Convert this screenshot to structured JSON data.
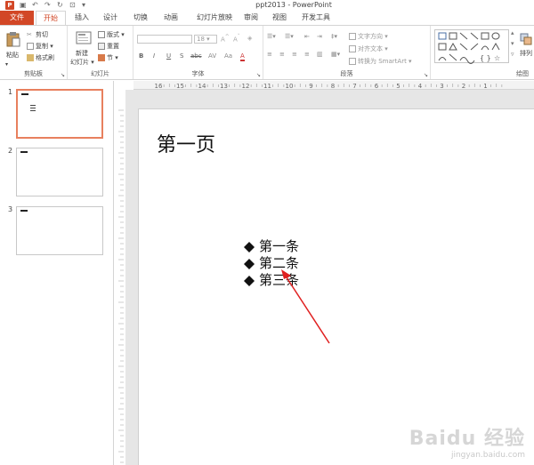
{
  "titlebar": {
    "title": "ppt2013 - PowerPoint"
  },
  "tabs": [
    "文件",
    "开始",
    "插入",
    "设计",
    "切换",
    "动画",
    "幻灯片放映",
    "审阅",
    "视图",
    "开发工具"
  ],
  "ribbon": {
    "clipboard": {
      "paste": "粘贴",
      "cut": "剪切",
      "copy": "复制",
      "format_painter": "格式刷",
      "label": "剪贴板"
    },
    "slides": {
      "new_slide_1": "新建",
      "new_slide_2": "幻灯片",
      "layout": "版式",
      "reset": "重置",
      "section": "节",
      "label": "幻灯片"
    },
    "font": {
      "size": "18",
      "label": "字体",
      "bold": "B",
      "italic": "I",
      "underline": "U",
      "strike": "S",
      "abc": "abc"
    },
    "paragraph": {
      "text_direction": "文字方向",
      "align_text": "对齐文本",
      "smartart": "转换为 SmartArt",
      "label": "段落"
    },
    "drawing": {
      "arrange": "排列",
      "label": "绘图"
    }
  },
  "ruler": {
    "labels": [
      "16",
      "15",
      "14",
      "13",
      "12",
      "11",
      "10",
      "9",
      "8",
      "7",
      "6",
      "5",
      "4",
      "3",
      "2",
      "1"
    ]
  },
  "thumbnails": [
    {
      "num": "1",
      "selected": true
    },
    {
      "num": "2",
      "selected": false
    },
    {
      "num": "3",
      "selected": false
    }
  ],
  "slide": {
    "title": "第一页",
    "bullets": [
      "第一条",
      "第二条",
      "第三条"
    ]
  },
  "colors": {
    "accent": "#d24726",
    "selection": "#e8805e",
    "arrow": "#e02020"
  },
  "watermark": {
    "logo": "Baidu 经验",
    "url": "jingyan.baidu.com"
  }
}
